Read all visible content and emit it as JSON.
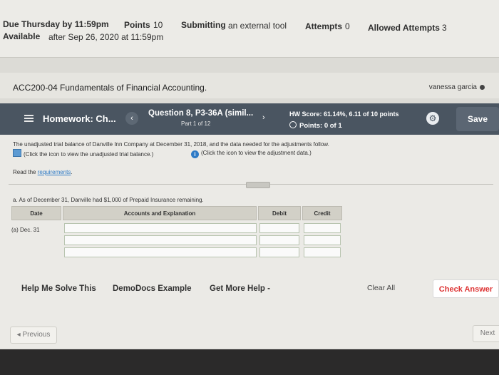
{
  "assignment_meta": {
    "due": "Due Thursday by 11:59pm",
    "points_label": "Points",
    "points_value": "10",
    "submitting_label": "Submitting",
    "submitting_value": "an external tool",
    "attempts_label": "Attempts",
    "attempts_value": "0",
    "allowed_label": "Allowed Attempts",
    "allowed_value": "3",
    "available_label": "Available",
    "available_value": "after Sep 26, 2020 at 11:59pm"
  },
  "course": {
    "title": "ACC200-04 Fundamentals of Financial Accounting.",
    "user": "vanessa garcia"
  },
  "hw_header": {
    "homework": "Homework: Ch...",
    "question": "Question 8, P3-36A (simil...",
    "part": "Part 1 of 12",
    "score": "HW Score: 61.14%, 6.11 of 10 points",
    "points": "Points: 0 of 1",
    "save": "Save"
  },
  "problem": {
    "intro": "The unadjusted trial balance of Danville Inn Company at December 31, 2018, and the data needed for the adjustments follow.",
    "trial_link": "(Click the icon to view the unadjusted trial balance.)",
    "adjust_link": "(Click the icon to view the adjustment data.)",
    "read_prefix": "Read the",
    "read_link": "requirements",
    "read_suffix": ".",
    "question_a": "a. As of December 31, Danville had $1,000 of Prepaid Insurance remaining."
  },
  "journal_table": {
    "headers": [
      "Date",
      "Accounts and Explanation",
      "Debit",
      "Credit"
    ],
    "date_label": "(a) Dec. 31"
  },
  "actions": {
    "help": "Help Me Solve This",
    "demo": "DemoDocs Example",
    "more": "Get More Help -",
    "clear": "Clear All",
    "check": "Check Answer",
    "previous": "Previous",
    "next": "Next"
  }
}
